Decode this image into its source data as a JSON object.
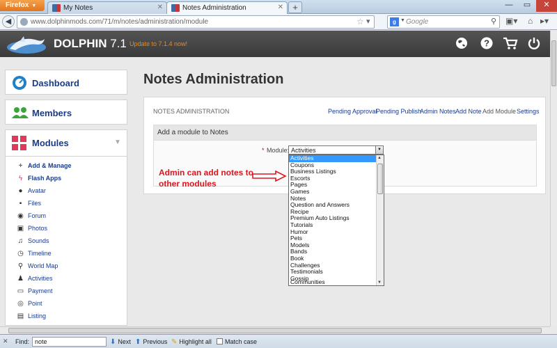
{
  "browser": {
    "menu_button": "Firefox",
    "tabs": [
      {
        "label": "My Notes",
        "active": false
      },
      {
        "label": "Notes Administration",
        "active": true
      }
    ],
    "url": "www.dolphinmods.com/71/m/notes/administration/module",
    "search_placeholder": "Google"
  },
  "header": {
    "brand": "DOLPHIN",
    "version": "7.1",
    "update_text": "Update to 7.1.4 now!"
  },
  "sidebar": {
    "dashboard": "Dashboard",
    "members": "Members",
    "modules": "Modules",
    "items": [
      {
        "label": "Add & Manage",
        "icon": "plus-icon"
      },
      {
        "label": "Flash Apps",
        "icon": "bolt-icon"
      },
      {
        "label": "Avatar",
        "icon": "user-icon"
      },
      {
        "label": "Files",
        "icon": "save-icon"
      },
      {
        "label": "Forum",
        "icon": "chat-icon"
      },
      {
        "label": "Photos",
        "icon": "picture-icon"
      },
      {
        "label": "Sounds",
        "icon": "music-icon"
      },
      {
        "label": "Timeline",
        "icon": "clock-icon"
      },
      {
        "label": "World Map",
        "icon": "map-marker-icon"
      },
      {
        "label": "Activities",
        "icon": "activity-icon"
      },
      {
        "label": "Payment",
        "icon": "card-icon"
      },
      {
        "label": "Point",
        "icon": "target-icon"
      },
      {
        "label": "Listing",
        "icon": "briefcase-icon"
      }
    ]
  },
  "main": {
    "title": "Notes Administration",
    "panel_label": "NOTES ADMINISTRATION",
    "links": [
      "Pending Approval",
      "Pending Publish",
      "Admin Notes",
      "Add Note",
      "Add Module",
      "Settings"
    ],
    "form_title": "Add a module to Notes",
    "required_mark": "*",
    "module_label": "Module:",
    "selected_module": "Activities",
    "options": [
      "Activities",
      "Coupons",
      "Business Listings",
      "Escorts",
      "Pages",
      "Games",
      "Notes",
      "Question and Answers",
      "Recipe",
      "Premium Auto Listings",
      "Tutorials",
      "Humor",
      "Pets",
      "Models",
      "Bands",
      "Book",
      "Challenges",
      "Testimonials",
      "Gossip",
      "Communities"
    ],
    "annotation_line1": "Admin can add notes to",
    "annotation_line2": "other modules"
  },
  "findbar": {
    "label": "Find:",
    "value": "note",
    "next": "Next",
    "previous": "Previous",
    "highlight": "Highlight all",
    "match_case": "Match case"
  },
  "colors": {
    "accent_blue": "#1a3b8a",
    "select_highlight": "#3399ff",
    "annotation_red": "#e0141e",
    "update_orange": "#f08a1a"
  }
}
